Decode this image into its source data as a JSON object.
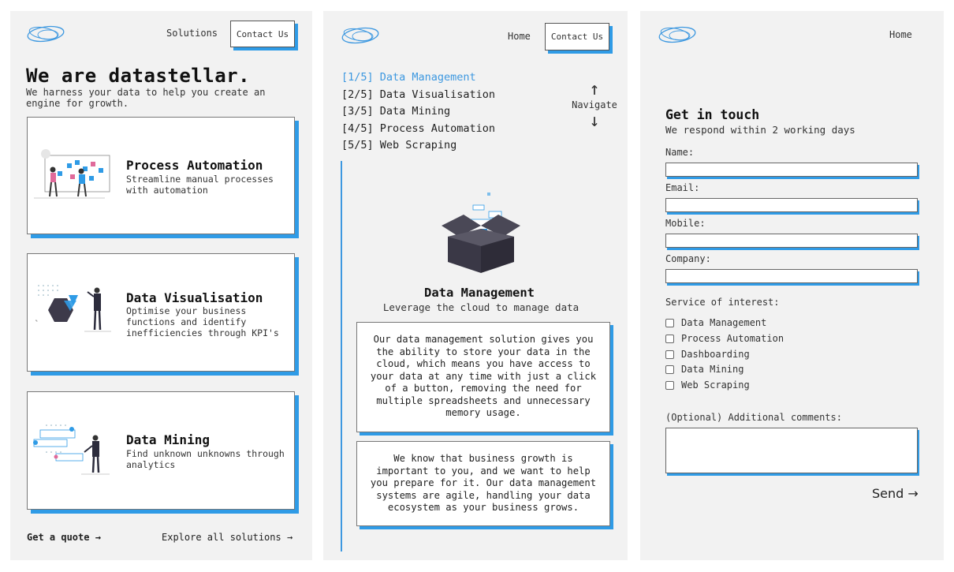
{
  "colors": {
    "accent": "#2f9be6",
    "panel_bg": "#f2f2f2",
    "active_link": "#3d98e0"
  },
  "panel1": {
    "nav": {
      "solutions": "Solutions",
      "contact": "Contact Us"
    },
    "hero": {
      "title": "We are datastellar.",
      "subtitle": "We harness your data to help you create an engine for growth."
    },
    "cards": [
      {
        "title": "Process Automation",
        "desc": "Streamline manual processes with automation",
        "icon": "process-automation-illustration"
      },
      {
        "title": "Data Visualisation",
        "desc": "Optimise your business functions and identify inefficiencies through KPI's",
        "icon": "data-visualisation-illustration"
      },
      {
        "title": "Data Mining",
        "desc": "Find unknown unknowns through analytics",
        "icon": "data-mining-illustration"
      }
    ],
    "footer": {
      "quote": "Get a quote →",
      "explore": "Explore all solutions →"
    }
  },
  "panel2": {
    "nav": {
      "home": "Home",
      "contact": "Contact Us"
    },
    "services": [
      {
        "label": "[1/5] Data Management",
        "active": true
      },
      {
        "label": "[2/5] Data Visualisation",
        "active": false
      },
      {
        "label": "[3/5] Data Mining",
        "active": false
      },
      {
        "label": "[4/5] Process Automation",
        "active": false
      },
      {
        "label": "[5/5] Web Scraping",
        "active": false
      }
    ],
    "navigate": {
      "up": "↑",
      "label": "Navigate",
      "down": "↓"
    },
    "detail": {
      "title": "Data Management",
      "subtitle": "Leverage the cloud to manage data",
      "para1": "Our data management solution gives you the ability to store your data in the cloud, which means you have access to your data at any time with just a click of a button, removing the need for multiple spreadsheets and unnecessary memory usage.",
      "para2": "We know that business growth is important to you, and we want to help you prepare for it. Our data management systems are agile, handling your data ecosystem as your business grows."
    }
  },
  "panel3": {
    "nav": {
      "home": "Home"
    },
    "form": {
      "title": "Get in touch",
      "subtitle": "We respond within 2 working days",
      "name_label": "Name:",
      "email_label": "Email:",
      "mobile_label": "Mobile:",
      "company_label": "Company:",
      "service_label": "Service of interest:",
      "services": [
        "Data Management",
        "Process Automation",
        "Dashboarding",
        "Data Mining",
        "Web Scraping"
      ],
      "comments_label": "(Optional) Additional comments:",
      "send": "Send →"
    }
  }
}
